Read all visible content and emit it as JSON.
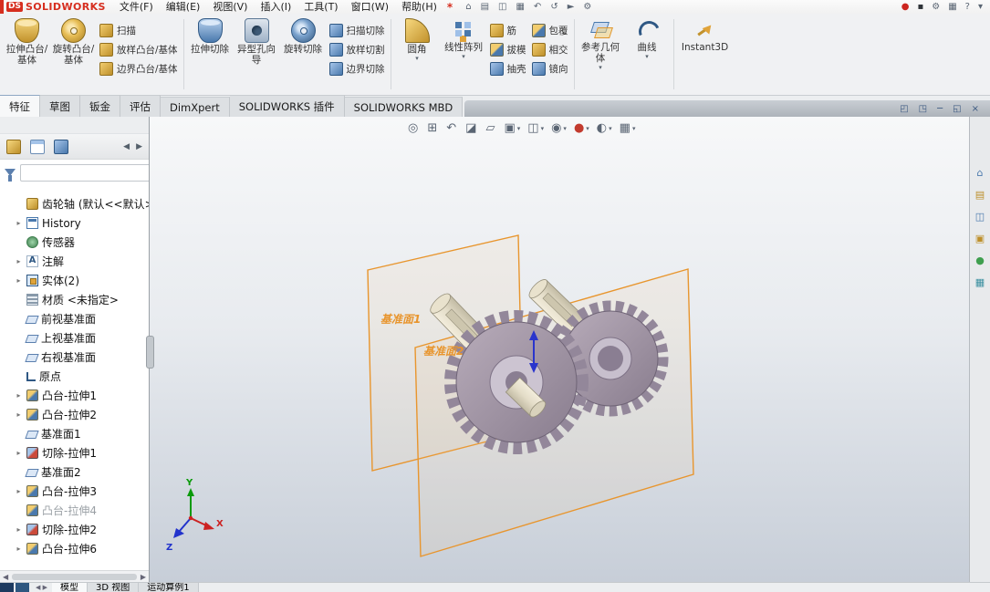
{
  "logo": {
    "ds": "DS",
    "brand": "SOLIDWORKS"
  },
  "glyphs": {
    "caret": "▾"
  },
  "menubar": {
    "items": [
      "文件(F)",
      "编辑(E)",
      "视图(V)",
      "插入(I)",
      "工具(T)",
      "窗口(W)",
      "帮助(H)"
    ],
    "flyout_star": "*",
    "quick_icons": [
      {
        "glyph": "⌂",
        "name": "home-icon"
      },
      {
        "glyph": "▤",
        "name": "open-document-icon"
      },
      {
        "glyph": "◫",
        "name": "save-icon"
      },
      {
        "glyph": "▦",
        "name": "print-icon"
      },
      {
        "glyph": "↶",
        "name": "undo-icon"
      },
      {
        "glyph": "↺",
        "name": "rebuild-icon"
      },
      {
        "glyph": "►",
        "name": "select-icon"
      },
      {
        "glyph": "⚙",
        "name": "options-icon"
      }
    ],
    "right_icons": [
      {
        "glyph": "●",
        "name": "presence-icon",
        "cls": "c-red"
      },
      {
        "glyph": "▪",
        "name": "apps-icon",
        "cls": "c-dark"
      },
      {
        "glyph": "⚙",
        "name": "settings-icon",
        "cls": "c-gray"
      },
      {
        "glyph": "▦",
        "name": "window-layout-icon",
        "cls": "c-gray"
      },
      {
        "glyph": "?",
        "name": "help-icon",
        "cls": "c-gray"
      },
      {
        "glyph": "▾",
        "name": "more-icon",
        "cls": "c-gray"
      }
    ]
  },
  "ribbon": {
    "big": [
      "拉伸凸台/基体",
      "旋转凸台/基体",
      "拉伸切除",
      "异型孔向导",
      "旋转切除",
      "圆角",
      "线性阵列",
      "参考几何体",
      "曲线"
    ],
    "stacks": [
      [
        "扫描",
        "放样凸台/基体",
        "边界凸台/基体"
      ],
      [
        "扫描切除",
        "放样切割",
        "边界切除"
      ],
      [
        "筋",
        "拔模",
        "抽壳"
      ],
      [
        "包覆",
        "相交",
        "镜向"
      ]
    ],
    "instant3d": "Instant3D"
  },
  "tabs": {
    "items": [
      {
        "label": "特征",
        "state": "active"
      },
      {
        "label": "草图",
        "state": ""
      },
      {
        "label": "钣金",
        "state": ""
      },
      {
        "label": "评估",
        "state": ""
      },
      {
        "label": "DimXpert",
        "state": ""
      },
      {
        "label": "SOLIDWORKS 插件",
        "state": ""
      },
      {
        "label": "SOLIDWORKS MBD",
        "state": ""
      }
    ]
  },
  "doc_controls": [
    {
      "glyph": "◰",
      "name": "split-pane-icon"
    },
    {
      "glyph": "◳",
      "name": "new-window-icon"
    },
    {
      "glyph": "─",
      "name": "minimize-window-icon"
    },
    {
      "glyph": "◱",
      "name": "restore-window-icon"
    },
    {
      "glyph": "×",
      "name": "close-window-icon"
    }
  ],
  "panel": {
    "nav": [
      {
        "glyph": "◀",
        "name": "panel-prev-icon"
      },
      {
        "glyph": "▶",
        "name": "panel-next-icon"
      }
    ]
  },
  "tree": {
    "items": [
      {
        "exp": "",
        "icon": "ico-part",
        "label": "齿轮轴 (默认<<默认>_显示",
        "state": ""
      },
      {
        "exp": "▸",
        "icon": "ico-history",
        "label": "History",
        "state": ""
      },
      {
        "exp": "",
        "icon": "ico-sensor",
        "label": "传感器",
        "state": ""
      },
      {
        "exp": "▸",
        "icon": "ico-ann",
        "label": "注解",
        "state": ""
      },
      {
        "exp": "▸",
        "icon": "ico-bodies",
        "label": "实体(2)",
        "state": ""
      },
      {
        "exp": "",
        "icon": "ico-material",
        "label": "材质 <未指定>",
        "state": ""
      },
      {
        "exp": "",
        "icon": "ico-plane",
        "label": "前视基准面",
        "state": ""
      },
      {
        "exp": "",
        "icon": "ico-plane",
        "label": "上视基准面",
        "state": ""
      },
      {
        "exp": "",
        "icon": "ico-plane",
        "label": "右视基准面",
        "state": ""
      },
      {
        "exp": "",
        "icon": "ico-origin",
        "label": "原点",
        "state": ""
      },
      {
        "exp": "▸",
        "icon": "ico-boss",
        "label": "凸台-拉伸1",
        "state": ""
      },
      {
        "exp": "▸",
        "icon": "ico-boss",
        "label": "凸台-拉伸2",
        "state": ""
      },
      {
        "exp": "",
        "icon": "ico-plane",
        "label": "基准面1",
        "state": ""
      },
      {
        "exp": "▸",
        "icon": "ico-cut",
        "label": "切除-拉伸1",
        "state": ""
      },
      {
        "exp": "",
        "icon": "ico-plane",
        "label": "基准面2",
        "state": ""
      },
      {
        "exp": "▸",
        "icon": "ico-boss",
        "label": "凸台-拉伸3",
        "state": ""
      },
      {
        "exp": "",
        "icon": "ico-boss",
        "label": "凸台-拉伸4",
        "state": "suppressed"
      },
      {
        "exp": "▸",
        "icon": "ico-cut",
        "label": "切除-拉伸2",
        "state": ""
      },
      {
        "exp": "▸",
        "icon": "ico-boss",
        "label": "凸台-拉伸6",
        "state": ""
      }
    ]
  },
  "viewport": {
    "plane1_label": "基准面1",
    "plane2_label": "基准面2",
    "triad": {
      "x": "X",
      "y": "Y",
      "z": "Z"
    },
    "hud": [
      {
        "glyph": "◎",
        "caret": "",
        "name": "zoom-fit-icon",
        "cls": ""
      },
      {
        "glyph": "⊞",
        "caret": "",
        "name": "zoom-area-icon",
        "cls": ""
      },
      {
        "glyph": "↶",
        "caret": "",
        "name": "previous-view-icon",
        "cls": ""
      },
      {
        "glyph": "◪",
        "caret": "",
        "name": "section-view-icon",
        "cls": ""
      },
      {
        "glyph": "▱",
        "caret": "",
        "name": "annotation-view-icon",
        "cls": ""
      },
      {
        "glyph": "▣",
        "caret": "▾",
        "name": "view-orientation-icon",
        "cls": ""
      },
      {
        "glyph": "◫",
        "caret": "▾",
        "name": "display-style-icon",
        "cls": ""
      },
      {
        "glyph": "◉",
        "caret": "▾",
        "name": "hide-show-items-icon",
        "cls": ""
      },
      {
        "glyph": "●",
        "caret": "▾",
        "name": "edit-appearance-icon",
        "cls": "c-appearance"
      },
      {
        "glyph": "◐",
        "caret": "▾",
        "name": "apply-scene-icon",
        "cls": ""
      },
      {
        "glyph": "▦",
        "caret": "▾",
        "name": "view-settings-icon",
        "cls": ""
      }
    ]
  },
  "right_panel": {
    "icons": [
      {
        "glyph": "⌂",
        "name": "home-icon",
        "cls": "c-blue"
      },
      {
        "glyph": "▤",
        "name": "design-library-icon",
        "cls": "c-gold"
      },
      {
        "glyph": "◫",
        "name": "file-explorer-icon",
        "cls": "c-blue"
      },
      {
        "glyph": "▣",
        "name": "view-palette-icon",
        "cls": "c-gold"
      },
      {
        "glyph": "●",
        "name": "appearances-icon",
        "cls": "c-green"
      },
      {
        "glyph": "▦",
        "name": "custom-properties-icon",
        "cls": "c-teal"
      }
    ]
  },
  "statusbar": {
    "nav": "◀ ▶",
    "tabs": [
      {
        "label": "模型",
        "state": "active"
      },
      {
        "label": "3D 视图",
        "state": ""
      },
      {
        "label": "运动算例1",
        "state": ""
      }
    ]
  }
}
